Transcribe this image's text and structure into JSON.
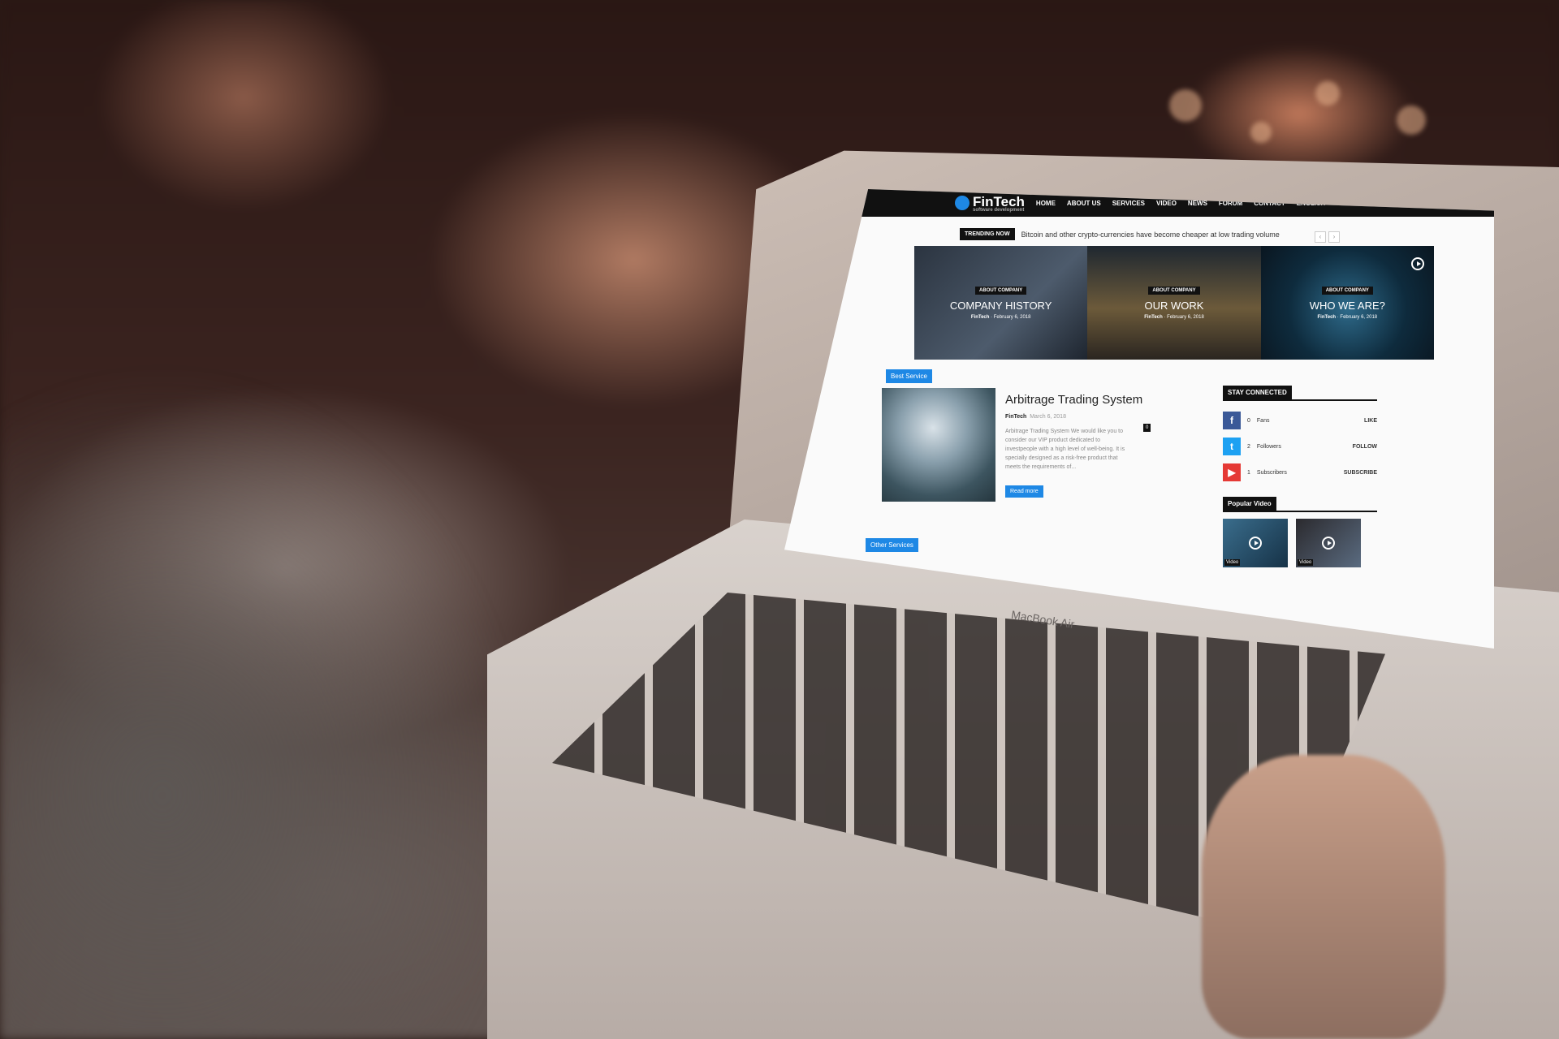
{
  "site": {
    "logo_text": "FinTech",
    "logo_tagline": "software development",
    "nav": [
      "HOME",
      "ABOUT US",
      "SERVICES",
      "VIDEO",
      "NEWS",
      "FORUM",
      "CONTACT",
      "ENGLISH"
    ],
    "trending_label": "TRENDING NOW",
    "trending_text": "Bitcoin and other crypto-currencies have become cheaper at low trading volume",
    "hero_tiles": [
      {
        "category": "ABOUT COMPANY",
        "title": "COMPANY HISTORY",
        "author": "FinTech",
        "date": "February 6, 2018"
      },
      {
        "category": "ABOUT COMPANY",
        "title": "OUR WORK",
        "author": "FinTech",
        "date": "February 6, 2018"
      },
      {
        "category": "ABOUT COMPANY",
        "title": "WHO WE ARE?",
        "author": "FinTech",
        "date": "February 6, 2018"
      }
    ],
    "best_service_tag": "Best Service",
    "article": {
      "title": "Arbitrage Trading System",
      "author": "FinTech",
      "date": "March 6, 2018",
      "comments": "0",
      "excerpt": "Arbitrage Trading System We would like you to consider our VIP product dedicated to investpeople with a high level of well-being. It is specially designed as a risk-free product that meets the requirements of...",
      "read_more": "Read more"
    },
    "other_services_tag": "Other Services",
    "stay_connected": "STAY CONNECTED",
    "social": [
      {
        "icon": "f",
        "count": "0",
        "label": "Fans",
        "action": "LIKE",
        "color": "#3b5998"
      },
      {
        "icon": "t",
        "count": "2",
        "label": "Followers",
        "action": "FOLLOW",
        "color": "#1da1f2"
      },
      {
        "icon": "▶",
        "count": "1",
        "label": "Subscribers",
        "action": "SUBSCRIBE",
        "color": "#e53935"
      }
    ],
    "popular_video": "Popular Video",
    "videos": [
      {
        "label": "Video"
      },
      {
        "label": "Video"
      }
    ]
  },
  "laptop_brand": "MacBook Air"
}
